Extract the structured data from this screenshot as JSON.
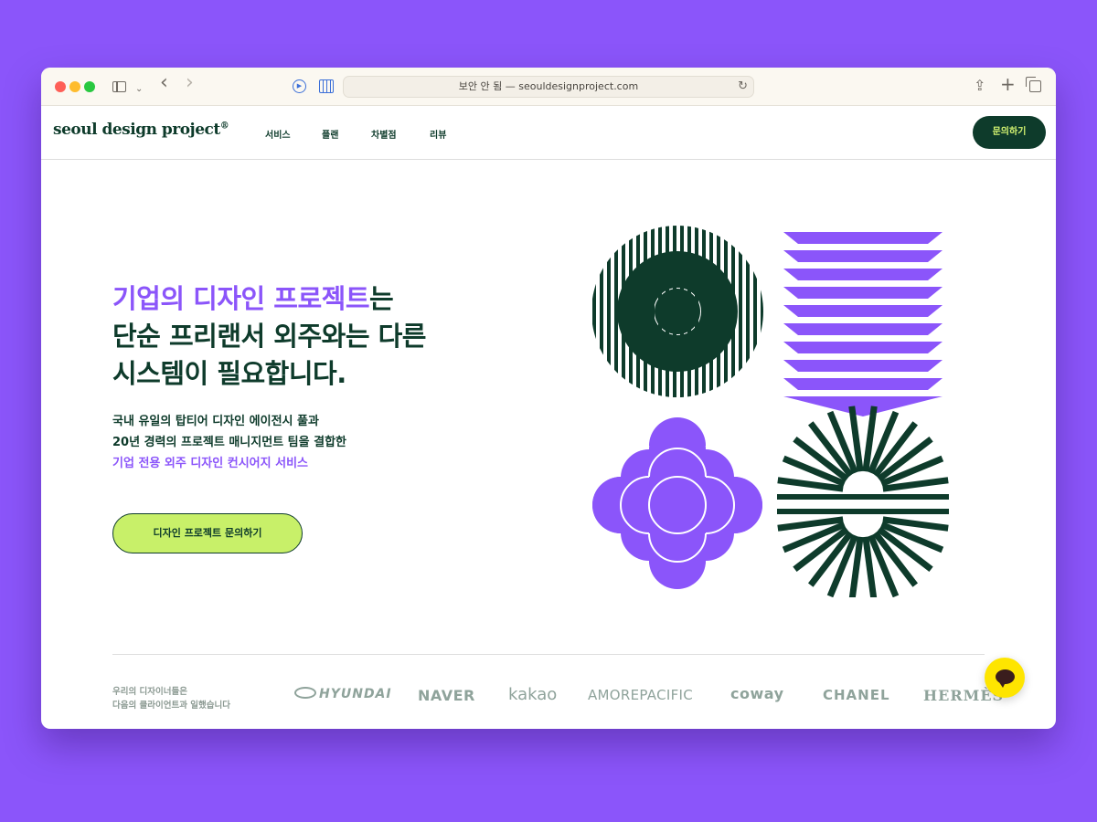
{
  "browser": {
    "address": "보안 안 됨 — seouldesignproject.com"
  },
  "nav": {
    "logo": "seoul design project",
    "logo_mark": "®",
    "links": [
      "서비스",
      "플랜",
      "차별점",
      "리뷰"
    ],
    "contact_label": "문의하기"
  },
  "hero": {
    "title_highlight": "기업의 디자인 프로젝트",
    "title_line1_rest": "는",
    "title_line2": "단순 프리랜서 외주와는 다른",
    "title_line3": "시스템이 필요합니다.",
    "desc_line1": "국내 유일의 탑티어 디자인 에이전시 풀과",
    "desc_line2": "20년 경력의 프로젝트 매니지먼트 팀을 결합한",
    "desc_line3": "기업 전용 외주 디자인 컨시어지 서비스",
    "cta_label": "디자인 프로젝트 문의하기"
  },
  "clients": {
    "label_line1": "우리의 디자이너들은",
    "label_line2": "다음의 클라이언트과 일했습니다",
    "logos": [
      "HYUNDAI",
      "NAVER",
      "kakao",
      "AMOREPACIFIC",
      "coway",
      "CHANEL",
      "HERMÈS"
    ]
  },
  "colors": {
    "brand_green": "#0e3b2b",
    "brand_purple": "#8b55fa",
    "cta_lime": "#c8f069",
    "kakao_yellow": "#fee500"
  }
}
